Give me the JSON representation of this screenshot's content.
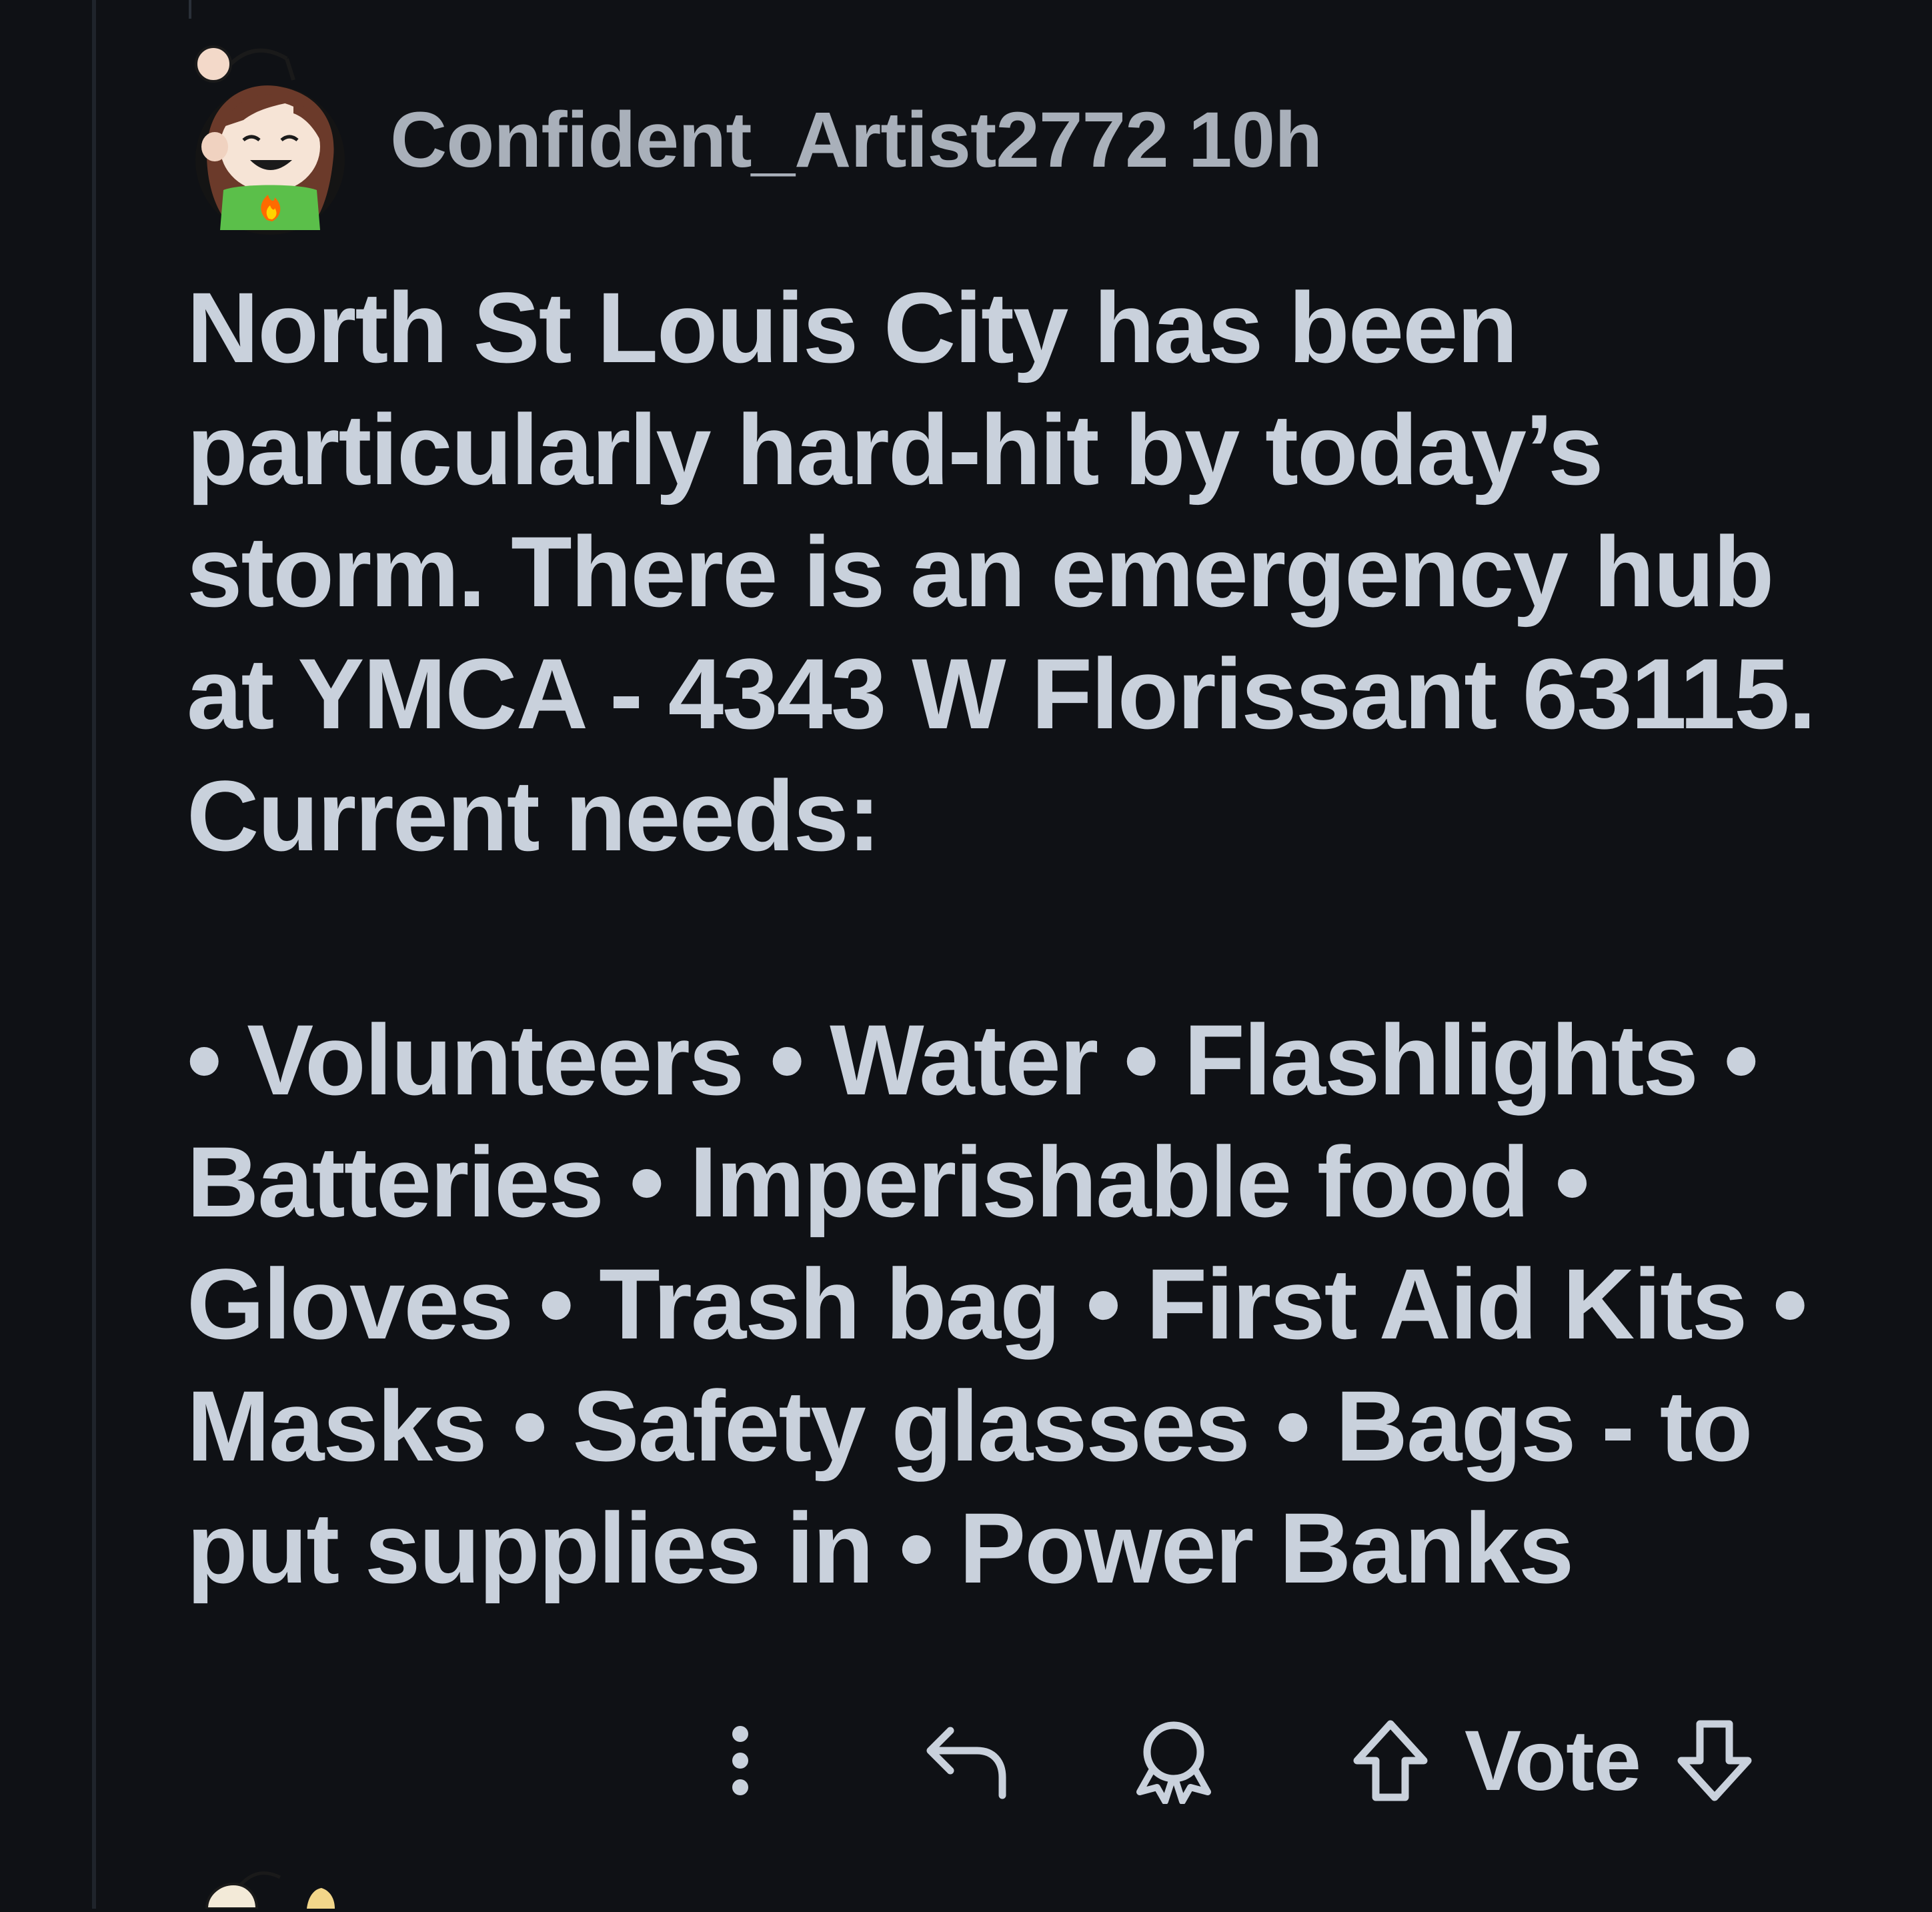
{
  "comment": {
    "username": "Confident_Artist2772",
    "time_ago": "10h",
    "avatar_icon": "avatar-icon",
    "body_intro": "North St Louis City has been particularly hard-hit by today’s storm. There is an emergency hub at YMCA - 4343 W Florissant 63115. Current needs:",
    "body_needs": "• Volunteers • Water • Flashlights • Batteries • Imperishable food • Gloves • Trash bag • First Aid Kits • Masks • Safety glasses • Bags - to put supplies in • Power Banks"
  },
  "actions": {
    "more_icon": "more-options-icon",
    "reply_icon": "reply-icon",
    "award_icon": "award-icon",
    "upvote_icon": "upvote-icon",
    "vote_label": "Vote",
    "downvote_icon": "downvote-icon"
  },
  "colors": {
    "background": "#0f1115",
    "text": "#c9d1dc",
    "meta_text": "#a9b0ba",
    "thread_line": "#1f242b"
  }
}
